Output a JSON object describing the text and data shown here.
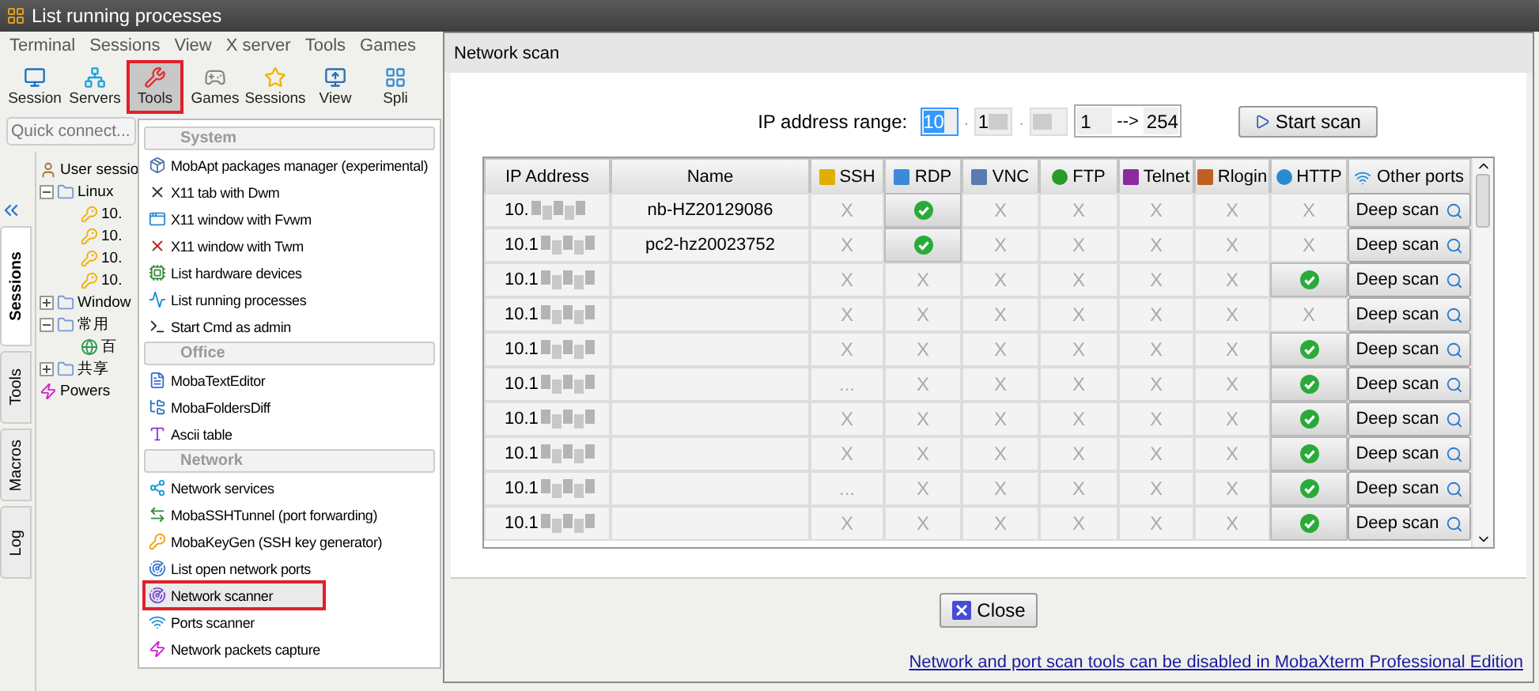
{
  "app": {
    "title": "List running processes",
    "menu": [
      "Terminal",
      "Sessions",
      "View",
      "X server",
      "Tools",
      "Games"
    ],
    "toolbar": [
      {
        "label": "Session",
        "selected": false
      },
      {
        "label": "Servers",
        "selected": false
      },
      {
        "label": "Tools",
        "selected": true
      },
      {
        "label": "Games",
        "selected": false
      },
      {
        "label": "Sessions",
        "selected": false
      },
      {
        "label": "View",
        "selected": false
      },
      {
        "label": "Spli",
        "selected": false
      }
    ],
    "quick_connect": {
      "placeholder": "Quick connect..."
    },
    "side_tabs": [
      {
        "label": "Sessions",
        "selected": true
      },
      {
        "label": "Tools",
        "selected": false
      },
      {
        "label": "Macros",
        "selected": false
      },
      {
        "label": "Log",
        "selected": false
      }
    ],
    "tree": [
      {
        "label": "User sessio",
        "kind": "user",
        "children": [
          {
            "label": "Linux",
            "kind": "folder",
            "expanded": true,
            "children": [
              {
                "label": "10.",
                "kind": "ssh"
              },
              {
                "label": "10.",
                "kind": "ssh"
              },
              {
                "label": "10.",
                "kind": "ssh"
              },
              {
                "label": "10.",
                "kind": "ssh"
              }
            ]
          },
          {
            "label": "Window",
            "kind": "folder",
            "expanded": false
          },
          {
            "label": "常用",
            "kind": "folder",
            "expanded": true,
            "children": [
              {
                "label": "百",
                "kind": "web"
              }
            ]
          },
          {
            "label": "共享",
            "kind": "folder",
            "expanded": false
          },
          {
            "label": "Powers",
            "kind": "shell"
          }
        ]
      }
    ],
    "tools_menu": [
      {
        "title": "System",
        "items": [
          {
            "label": "MobApt packages manager (experimental)",
            "selected": false
          },
          {
            "label": "X11 tab with Dwm",
            "selected": false
          },
          {
            "label": "X11 window with Fvwm",
            "selected": false
          },
          {
            "label": "X11 window with Twm",
            "selected": false
          },
          {
            "label": "List hardware devices",
            "selected": false
          },
          {
            "label": "List running processes",
            "selected": false
          },
          {
            "label": "Start Cmd as admin",
            "selected": false
          }
        ]
      },
      {
        "title": "Office",
        "items": [
          {
            "label": "MobaTextEditor",
            "selected": false
          },
          {
            "label": "MobaFoldersDiff",
            "selected": false
          },
          {
            "label": "Ascii table",
            "selected": false
          }
        ]
      },
      {
        "title": "Network",
        "items": [
          {
            "label": "Network services",
            "selected": false
          },
          {
            "label": "MobaSSHTunnel (port forwarding)",
            "selected": false
          },
          {
            "label": "MobaKeyGen (SSH key generator)",
            "selected": false
          },
          {
            "label": "List open network ports",
            "selected": false
          },
          {
            "label": "Network scanner",
            "selected": true
          },
          {
            "label": "Ports scanner",
            "selected": false
          },
          {
            "label": "Network packets capture",
            "selected": false
          }
        ]
      }
    ]
  },
  "dialog": {
    "title": "Network scan",
    "range_label": "IP address range:",
    "range_fields": [
      {
        "value": "10",
        "selected": true
      },
      {
        "value": "1",
        "selected": false
      },
      {
        "selected": false
      }
    ],
    "octet_separator": ".",
    "range_start": "1",
    "range_arrow": "-->",
    "range_end": "254",
    "start_button": "Start scan",
    "columns": [
      "IP Address",
      "Name",
      "SSH",
      "RDP",
      "VNC",
      "FTP",
      "Telnet",
      "Rlogin",
      "HTTP",
      "Other ports"
    ],
    "rows": [
      {
        "ip": "10.",
        "name": "nb-HZ20129086",
        "ports": [
          {
            "open": false,
            "text": "X"
          },
          {
            "open": true
          },
          {
            "open": false,
            "text": "X"
          },
          {
            "open": false,
            "text": "X"
          },
          {
            "open": false,
            "text": "X"
          },
          {
            "open": false,
            "text": "X"
          },
          {
            "open": false,
            "text": "X"
          }
        ],
        "action": "Deep scan"
      },
      {
        "ip": "10.1",
        "name": "pc2-hz20023752",
        "ports": [
          {
            "open": false,
            "text": "X"
          },
          {
            "open": true
          },
          {
            "open": false,
            "text": "X"
          },
          {
            "open": false,
            "text": "X"
          },
          {
            "open": false,
            "text": "X"
          },
          {
            "open": false,
            "text": "X"
          },
          {
            "open": false,
            "text": "X"
          }
        ],
        "action": "Deep scan"
      },
      {
        "ip": "10.1",
        "ports": [
          {
            "open": false,
            "text": "X"
          },
          {
            "open": false,
            "text": "X"
          },
          {
            "open": false,
            "text": "X"
          },
          {
            "open": false,
            "text": "X"
          },
          {
            "open": false,
            "text": "X"
          },
          {
            "open": false,
            "text": "X"
          },
          {
            "open": true
          }
        ],
        "action": "Deep scan"
      },
      {
        "ip": "10.1",
        "ports": [
          {
            "open": false,
            "text": "X"
          },
          {
            "open": false,
            "text": "X"
          },
          {
            "open": false,
            "text": "X"
          },
          {
            "open": false,
            "text": "X"
          },
          {
            "open": false,
            "text": "X"
          },
          {
            "open": false,
            "text": "X"
          },
          {
            "open": false,
            "text": "X"
          }
        ],
        "action": "Deep scan"
      },
      {
        "ip": "10.1",
        "ports": [
          {
            "open": false,
            "text": "X"
          },
          {
            "open": false,
            "text": "X"
          },
          {
            "open": false,
            "text": "X"
          },
          {
            "open": false,
            "text": "X"
          },
          {
            "open": false,
            "text": "X"
          },
          {
            "open": false,
            "text": "X"
          },
          {
            "open": true
          }
        ],
        "action": "Deep scan"
      },
      {
        "ip": "10.1",
        "ports": [
          {
            "open": false,
            "text": "..."
          },
          {
            "open": false,
            "text": "X"
          },
          {
            "open": false,
            "text": "X"
          },
          {
            "open": false,
            "text": "X"
          },
          {
            "open": false,
            "text": "X"
          },
          {
            "open": false,
            "text": "X"
          },
          {
            "open": true
          }
        ],
        "action": "Deep scan"
      },
      {
        "ip": "10.1",
        "ports": [
          {
            "open": false,
            "text": "X"
          },
          {
            "open": false,
            "text": "X"
          },
          {
            "open": false,
            "text": "X"
          },
          {
            "open": false,
            "text": "X"
          },
          {
            "open": false,
            "text": "X"
          },
          {
            "open": false,
            "text": "X"
          },
          {
            "open": true
          }
        ],
        "action": "Deep scan"
      },
      {
        "ip": "10.1",
        "ports": [
          {
            "open": false,
            "text": "X"
          },
          {
            "open": false,
            "text": "X"
          },
          {
            "open": false,
            "text": "X"
          },
          {
            "open": false,
            "text": "X"
          },
          {
            "open": false,
            "text": "X"
          },
          {
            "open": false,
            "text": "X"
          },
          {
            "open": true
          }
        ],
        "action": "Deep scan"
      },
      {
        "ip": "10.1",
        "ports": [
          {
            "open": false,
            "text": "..."
          },
          {
            "open": false,
            "text": "X"
          },
          {
            "open": false,
            "text": "X"
          },
          {
            "open": false,
            "text": "X"
          },
          {
            "open": false,
            "text": "X"
          },
          {
            "open": false,
            "text": "X"
          },
          {
            "open": true
          }
        ],
        "action": "Deep scan"
      },
      {
        "ip": "10.1",
        "ports": [
          {
            "open": false,
            "text": "X"
          },
          {
            "open": false,
            "text": "X"
          },
          {
            "open": false,
            "text": "X"
          },
          {
            "open": false,
            "text": "X"
          },
          {
            "open": false,
            "text": "X"
          },
          {
            "open": false,
            "text": "X"
          },
          {
            "open": true
          }
        ],
        "action": "Deep scan"
      }
    ],
    "close_button": "Close",
    "footer_link": "Network and port scan tools can be disabled in MobaXterm Professional Edition"
  }
}
